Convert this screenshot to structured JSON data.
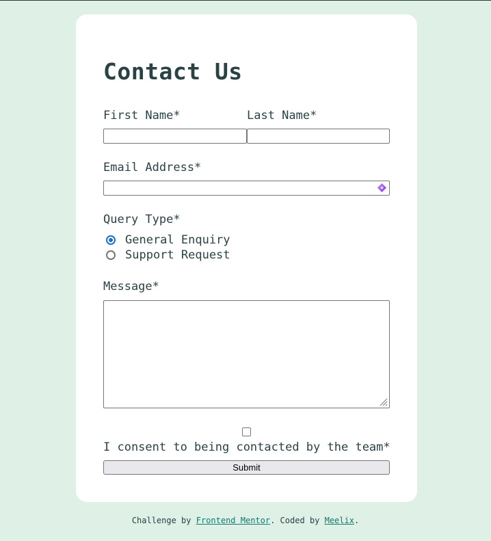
{
  "form": {
    "title": "Contact Us",
    "first_name_label": "First Name*",
    "first_name_value": "",
    "last_name_label": "Last Name*",
    "last_name_value": "",
    "email_label": "Email Address*",
    "email_value": "",
    "query_type_label": "Query Type*",
    "query_options": [
      {
        "label": "General Enquiry",
        "checked": true
      },
      {
        "label": "Support Request",
        "checked": false
      }
    ],
    "message_label": "Message*",
    "message_value": "",
    "consent_checked": false,
    "consent_label": "I consent to being contacted by the team*",
    "submit_label": "Submit"
  },
  "footer": {
    "prefix": "Challenge by ",
    "link1": "Frontend Mentor",
    "middle": ". Coded by ",
    "link2": "Meelix",
    "suffix": "."
  },
  "colors": {
    "page_background": "#dff0e6",
    "card_background": "#ffffff",
    "text": "#2a4244",
    "radio_accent": "#1a6fd0",
    "link": "#147a6a"
  },
  "icons": {
    "email_field_icon": "password-manager-icon"
  }
}
